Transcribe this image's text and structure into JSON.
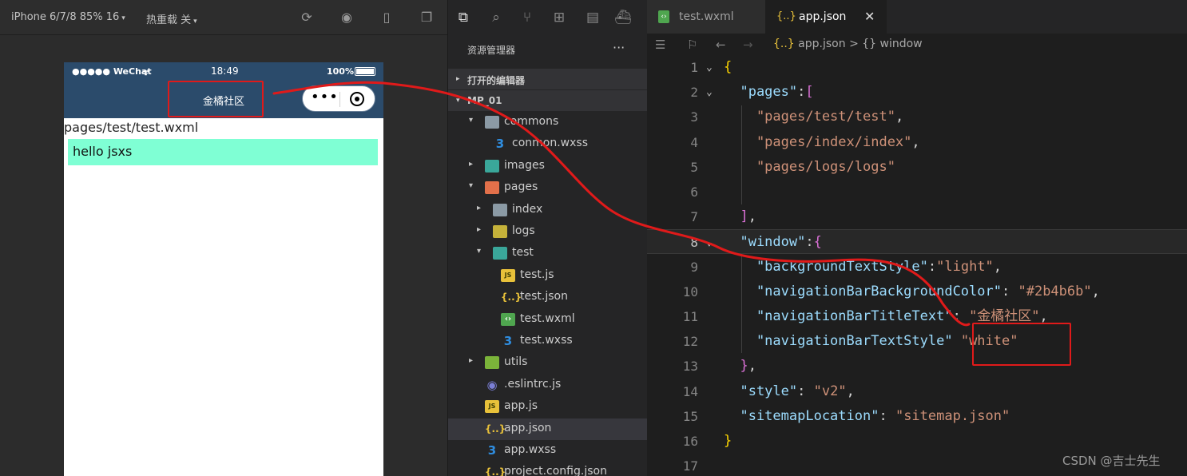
{
  "simulator": {
    "device": "iPhone 6/7/8 85% 16",
    "hot_reload": "热重载 关",
    "status_bar": {
      "carrier": "●●●●● WeChat",
      "time": "18:49",
      "battery": "100%"
    },
    "nav_title": "金橘社区",
    "capsule_more": "•••",
    "page_path": "pages/test/test.wxml",
    "hello_text": "hello jsxs"
  },
  "explorer": {
    "title": "资源管理器",
    "more": "···",
    "sections": {
      "open_editors": "打开的编辑器",
      "project": "MP_01"
    },
    "tree": [
      {
        "label": "commons",
        "arrow": "▾",
        "icon": "folder"
      },
      {
        "label": "conmon.wxss",
        "arrow": "",
        "icon": "css-icon"
      },
      {
        "label": "images",
        "arrow": "▸",
        "icon": "folder-images"
      },
      {
        "label": "pages",
        "arrow": "▾",
        "icon": "folder-pages"
      },
      {
        "label": "index",
        "arrow": "▸",
        "icon": "folder"
      },
      {
        "label": "logs",
        "arrow": "▸",
        "icon": "folder-logs"
      },
      {
        "label": "test",
        "arrow": "▾",
        "icon": "folder-test"
      },
      {
        "label": "test.js",
        "arrow": "",
        "icon": "js-icon"
      },
      {
        "label": "test.json",
        "arrow": "",
        "icon": "json-icon"
      },
      {
        "label": "test.wxml",
        "arrow": "",
        "icon": "wxml-icon"
      },
      {
        "label": "test.wxss",
        "arrow": "",
        "icon": "css-icon"
      },
      {
        "label": "utils",
        "arrow": "▸",
        "icon": "folder-utils"
      },
      {
        "label": ".eslintrc.js",
        "arrow": "",
        "icon": "eslint-icon"
      },
      {
        "label": "app.js",
        "arrow": "",
        "icon": "js-icon"
      },
      {
        "label": "app.json",
        "arrow": "",
        "icon": "json-icon",
        "selected": true
      },
      {
        "label": "app.wxss",
        "arrow": "",
        "icon": "css-icon"
      },
      {
        "label": "project.config.json",
        "arrow": "",
        "icon": "json-icon"
      }
    ]
  },
  "editor": {
    "tabs": [
      {
        "label": "test.wxml",
        "icon": "wxml-icon",
        "active": false
      },
      {
        "label": "app.json",
        "icon": "json-icon",
        "active": true
      }
    ],
    "tab_close": "✕",
    "breadcrumb": {
      "file": "app.json",
      "separator": ">",
      "symbol": "{} window"
    },
    "current_line": 8,
    "lines": [
      {
        "n": "1",
        "fold": "⌄",
        "tokens": [
          [
            "b1",
            "{"
          ]
        ]
      },
      {
        "n": "2",
        "fold": "⌄",
        "tokens": [
          [
            "k",
            "  \"pages\""
          ],
          [
            "p",
            ":"
          ],
          [
            "b2",
            "["
          ]
        ]
      },
      {
        "n": "3",
        "fold": "",
        "tokens": [
          [
            "s",
            "    \"pages/test/test\""
          ],
          [
            "p",
            ","
          ]
        ]
      },
      {
        "n": "4",
        "fold": "",
        "tokens": [
          [
            "s",
            "    \"pages/index/index\""
          ],
          [
            "p",
            ","
          ]
        ]
      },
      {
        "n": "5",
        "fold": "",
        "tokens": [
          [
            "s",
            "    \"pages/logs/logs\""
          ]
        ]
      },
      {
        "n": "6",
        "fold": "",
        "tokens": []
      },
      {
        "n": "7",
        "fold": "",
        "tokens": [
          [
            "b2",
            "  ]"
          ],
          [
            "p",
            ","
          ]
        ]
      },
      {
        "n": "8",
        "fold": "⌄",
        "tokens": [
          [
            "k",
            "  \"window\""
          ],
          [
            "p",
            ":"
          ],
          [
            "b2",
            "{"
          ]
        ]
      },
      {
        "n": "9",
        "fold": "",
        "tokens": [
          [
            "k",
            "    \"backgroundTextStyle\""
          ],
          [
            "p",
            ":"
          ],
          [
            "s",
            "\"light\""
          ],
          [
            "p",
            ","
          ]
        ]
      },
      {
        "n": "10",
        "fold": "",
        "tokens": [
          [
            "k",
            "    \"navigationBarBackgroundColor\""
          ],
          [
            "p",
            ": "
          ],
          [
            "s",
            "\"#2b4b6b\""
          ],
          [
            "p",
            ","
          ]
        ]
      },
      {
        "n": "11",
        "fold": "",
        "tokens": [
          [
            "k",
            "    \"navigationBarTitleText\""
          ],
          [
            "p",
            ": "
          ],
          [
            "s",
            "\"金橘社区\""
          ],
          [
            "p",
            ","
          ]
        ]
      },
      {
        "n": "12",
        "fold": "",
        "tokens": [
          [
            "k",
            "    \"navigationBarTextStyle\""
          ],
          [
            "p",
            " "
          ],
          [
            "s",
            "\"white\""
          ]
        ]
      },
      {
        "n": "13",
        "fold": "",
        "tokens": [
          [
            "b2",
            "  }"
          ],
          [
            "p",
            ","
          ]
        ]
      },
      {
        "n": "14",
        "fold": "",
        "tokens": [
          [
            "k",
            "  \"style\""
          ],
          [
            "p",
            ": "
          ],
          [
            "s",
            "\"v2\""
          ],
          [
            "p",
            ","
          ]
        ]
      },
      {
        "n": "15",
        "fold": "",
        "tokens": [
          [
            "k",
            "  \"sitemapLocation\""
          ],
          [
            "p",
            ": "
          ],
          [
            "s",
            "\"sitemap.json\""
          ]
        ]
      },
      {
        "n": "16",
        "fold": "",
        "tokens": [
          [
            "b1",
            "}"
          ]
        ]
      },
      {
        "n": "17",
        "fold": "",
        "tokens": []
      }
    ]
  },
  "watermark": "CSDN @吉士先生",
  "colors": {
    "nav_bg": "#2b4b6b",
    "hello_bg": "#7fffd4",
    "annotation": "#e01a1a"
  }
}
